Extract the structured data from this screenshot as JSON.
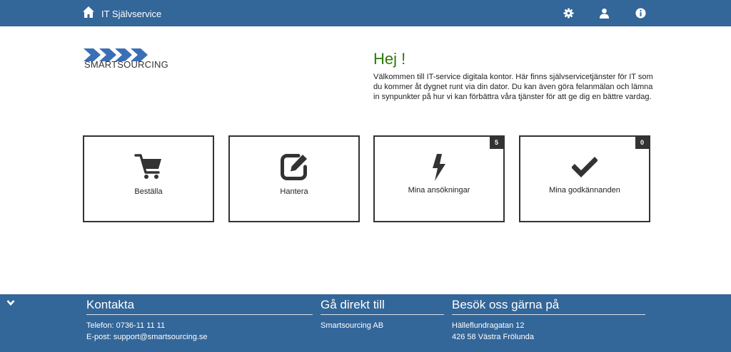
{
  "header": {
    "title": "IT Självservice"
  },
  "brand": {
    "logo_text": "SMARTSOURCING",
    "chevron_color": "#3a6fb5"
  },
  "welcome": {
    "greeting": "Hej !",
    "text": "Välkommen till IT-service digitala kontor. Här finns självservicetjänster för IT som du kommer åt dygnet runt via din dator. Du kan även göra felanmälan och lämna in synpunkter på hur vi kan förbättra våra tjänster för att ge dig en bättre vardag."
  },
  "tiles": [
    {
      "label": "Beställa",
      "icon": "shopping-cart-icon"
    },
    {
      "label": "Hantera",
      "icon": "edit-icon"
    },
    {
      "label": "Mina ansökningar",
      "icon": "lightning-bolt-icon",
      "badge": "5"
    },
    {
      "label": "Mina godkännanden",
      "icon": "checkmark-icon",
      "badge": "0"
    }
  ],
  "footer": {
    "contact": {
      "heading": "Kontakta",
      "phone": "Telefon: 0736-11 11 11",
      "email": "E-post: support@smartsourcing.se"
    },
    "direct": {
      "heading": "Gå direkt till",
      "link": "Smartsourcing AB"
    },
    "visit": {
      "heading": "Besök oss gärna på",
      "street": "Hälleflundragatan 12",
      "city": "426 58 Västra Frölunda"
    }
  },
  "colors": {
    "bar": "#336699",
    "greeting": "#2b7a0b",
    "tile_border": "#333333"
  }
}
